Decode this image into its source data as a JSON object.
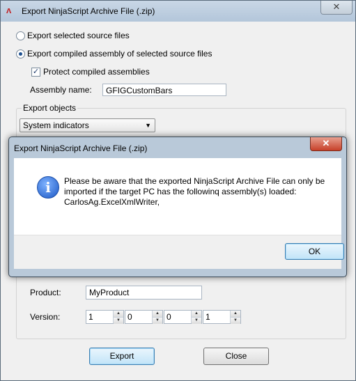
{
  "main_window": {
    "title": "Export NinjaScript Archive File (.zip)",
    "close_glyph": "✕",
    "app_icon_glyph": "ᴧ"
  },
  "options": {
    "export_source_label": "Export selected source files",
    "export_source_selected": false,
    "export_compiled_label": "Export compiled assembly of selected source files",
    "export_compiled_selected": true,
    "protect_label": "Protect compiled assemblies",
    "protect_checked": true,
    "assembly_name_label": "Assembly name:",
    "assembly_name_value": "GFIGCustomBars"
  },
  "export_objects": {
    "group_label": "Export objects",
    "selected": "System indicators"
  },
  "product": {
    "product_label": "Product:",
    "product_value": "MyProduct",
    "version_label": "Version:",
    "version_values": [
      "1",
      "0",
      "0",
      "1"
    ]
  },
  "buttons": {
    "export": "Export",
    "close": "Close"
  },
  "dialog": {
    "title": "Export NinjaScript Archive File (.zip)",
    "close_glyph": "✕",
    "icon_glyph": "i",
    "message_line1": "Please be aware that the exported NinjaScript Archive File can only be",
    "message_line2": "imported if the target PC has the followinq assembly(s) loaded:",
    "message_line3": "CarlosAg.ExcelXmlWriter,",
    "ok": "OK"
  }
}
